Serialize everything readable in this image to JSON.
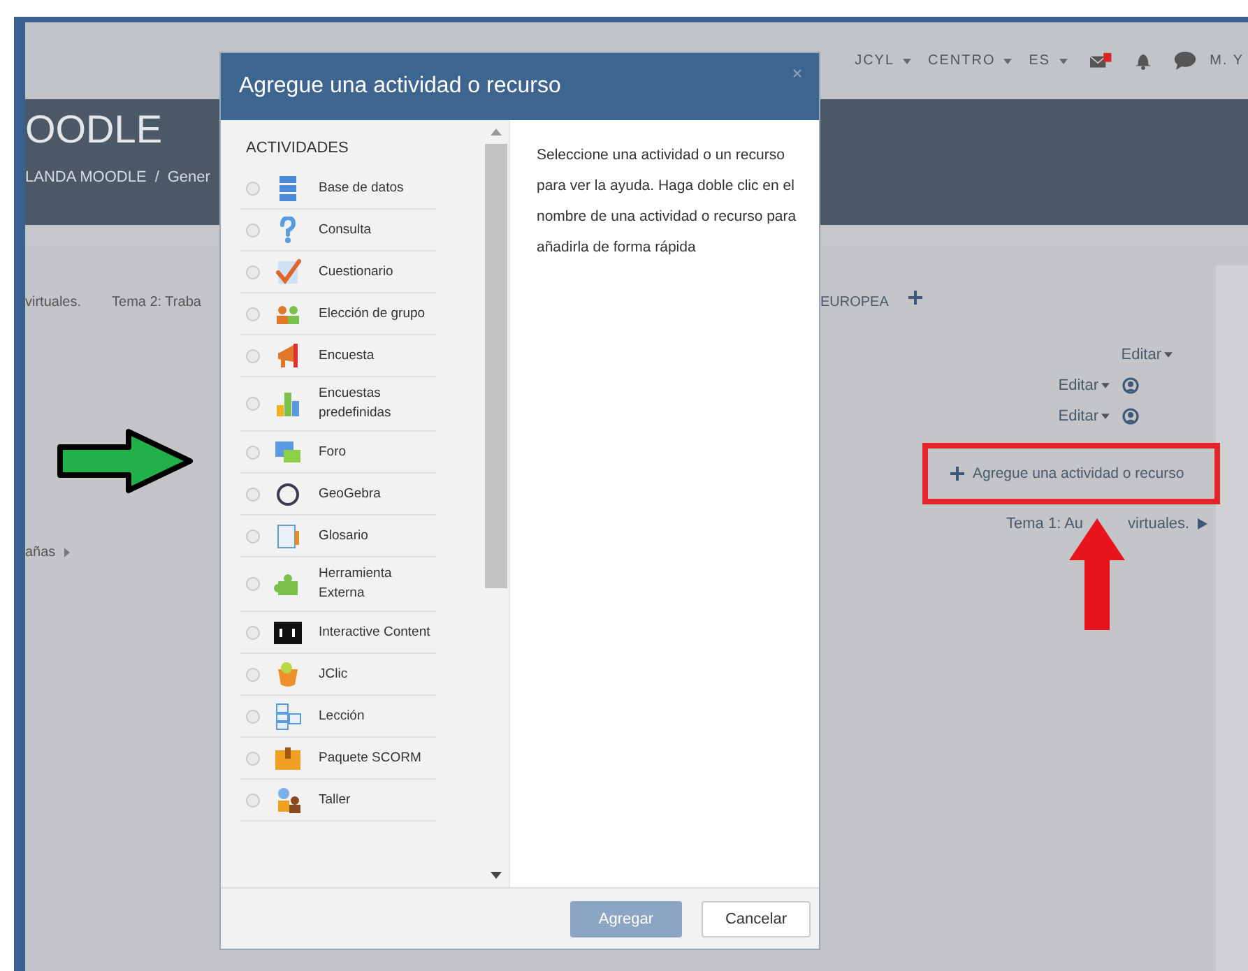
{
  "topnav": {
    "menus": [
      "JCYL",
      "CENTRO",
      "ES"
    ],
    "user": "M. Y"
  },
  "header": {
    "title": "OODLE",
    "breadcrumb": [
      "LANDA MOODLE",
      "Gener"
    ],
    "separator": "/"
  },
  "course": {
    "tabs_left": [
      "virtuales.",
      "Tema 2: Traba"
    ],
    "tab_right": "EUROPEA",
    "side_link": "añas"
  },
  "section": {
    "edit_links": [
      {
        "label": "Editar",
        "user_icon": false
      },
      {
        "label": "Editar",
        "user_icon": true
      },
      {
        "label": "Editar",
        "user_icon": true
      }
    ],
    "add_link": "Agregue una actividad o recurso",
    "next_link": [
      "Tema 1: Au",
      "virtuales."
    ]
  },
  "modal": {
    "title": "Agregue una actividad o recurso",
    "section": "ACTIVIDADES",
    "items": [
      {
        "label": "Base de datos",
        "selected": false
      },
      {
        "label": "Consulta",
        "selected": false
      },
      {
        "label": "Cuestionario",
        "selected": false
      },
      {
        "label": "Elección de grupo",
        "selected": false
      },
      {
        "label": "Encuesta",
        "selected": false
      },
      {
        "label": "Encuestas predefinidas",
        "selected": false
      },
      {
        "label": "Foro",
        "selected": false
      },
      {
        "label": "GeoGebra",
        "selected": false
      },
      {
        "label": "Glosario",
        "selected": false
      },
      {
        "label": "Herramienta Externa",
        "selected": false
      },
      {
        "label": "Interactive Content",
        "selected": false
      },
      {
        "label": "JClic",
        "selected": false
      },
      {
        "label": "Lección",
        "selected": false
      },
      {
        "label": "Paquete SCORM",
        "selected": false
      },
      {
        "label": "Taller",
        "selected": false
      }
    ],
    "help": "Seleccione una actividad o un recurso para ver la ayuda. Haga doble clic en el nombre de una actividad o recurso para añadirla de forma rápida",
    "buttons": [
      {
        "label": "Agregar",
        "kind": "primary"
      },
      {
        "label": "Cancelar",
        "kind": "secondary"
      }
    ]
  }
}
